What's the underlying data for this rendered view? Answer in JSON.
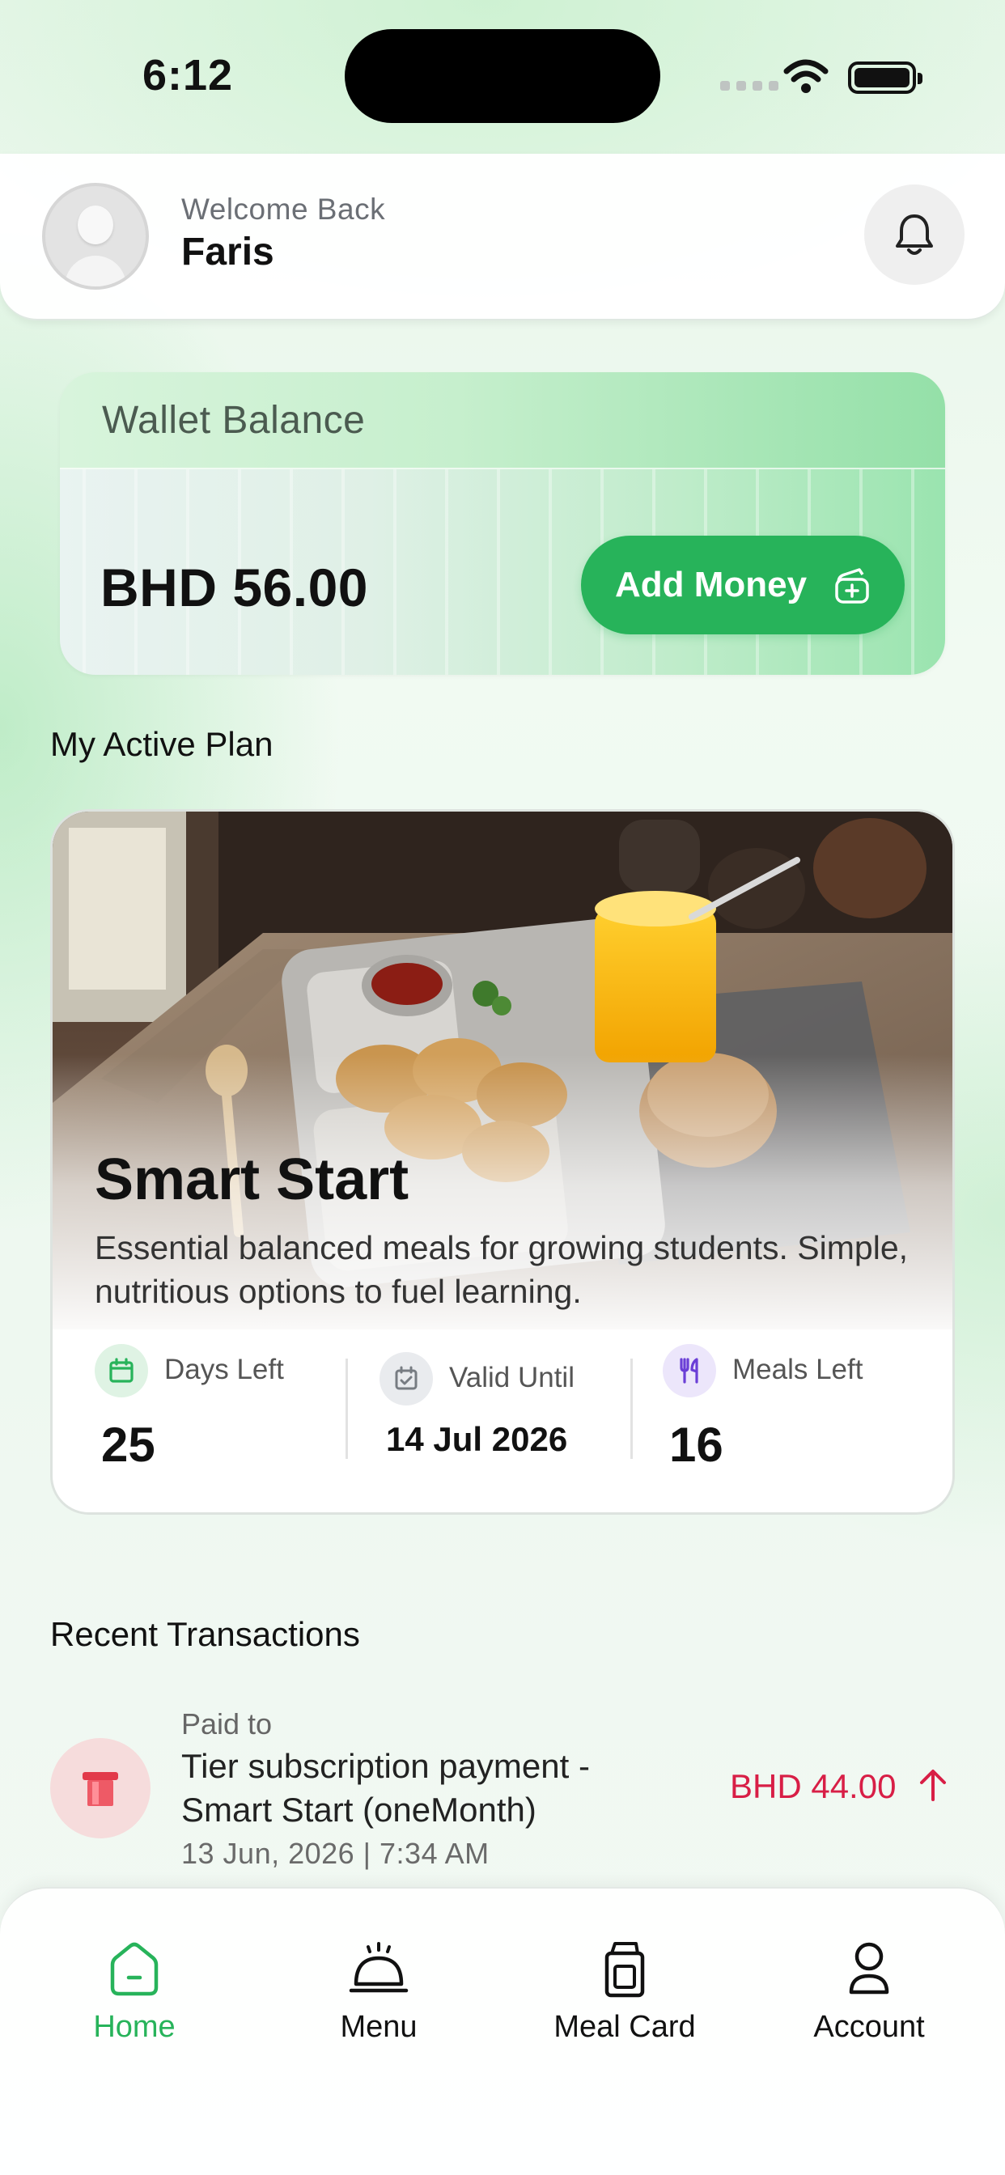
{
  "status_bar": {
    "time": "6:12"
  },
  "header": {
    "welcome": "Welcome Back",
    "user_name": "Faris"
  },
  "wallet": {
    "label": "Wallet Balance",
    "balance": "BHD 56.00",
    "add_money_label": "Add Money"
  },
  "active_plan": {
    "section_title": "My Active Plan",
    "name": "Smart Start",
    "description": "Essential balanced meals for growing students. Simple, nutritious options to fuel learning.",
    "stats": [
      {
        "label": "Days Left",
        "value": "25",
        "icon": "calendar-icon"
      },
      {
        "label": "Valid Until",
        "value": "14 Jul 2026",
        "icon": "calendar-check-icon"
      },
      {
        "label": "Meals Left",
        "value": "16",
        "icon": "utensils-icon"
      }
    ]
  },
  "transactions": {
    "section_title": "Recent Transactions",
    "items": [
      {
        "paid_to": "Paid to",
        "title": "Tier subscription payment - Smart Start (oneMonth)",
        "date": "13 Jun, 2026 | 7:34 AM",
        "amount": "BHD 44.00",
        "direction": "up"
      }
    ]
  },
  "bottom_nav": {
    "items": [
      {
        "label": "Home",
        "icon": "home-icon",
        "active": true
      },
      {
        "label": "Menu",
        "icon": "cloche-icon",
        "active": false
      },
      {
        "label": "Meal Card",
        "icon": "meal-card-icon",
        "active": false
      },
      {
        "label": "Account",
        "icon": "user-icon",
        "active": false
      }
    ]
  },
  "colors": {
    "accent_green": "#27b35a",
    "amount_red": "#d81e46",
    "meals_purple": "#6b3fd6"
  }
}
